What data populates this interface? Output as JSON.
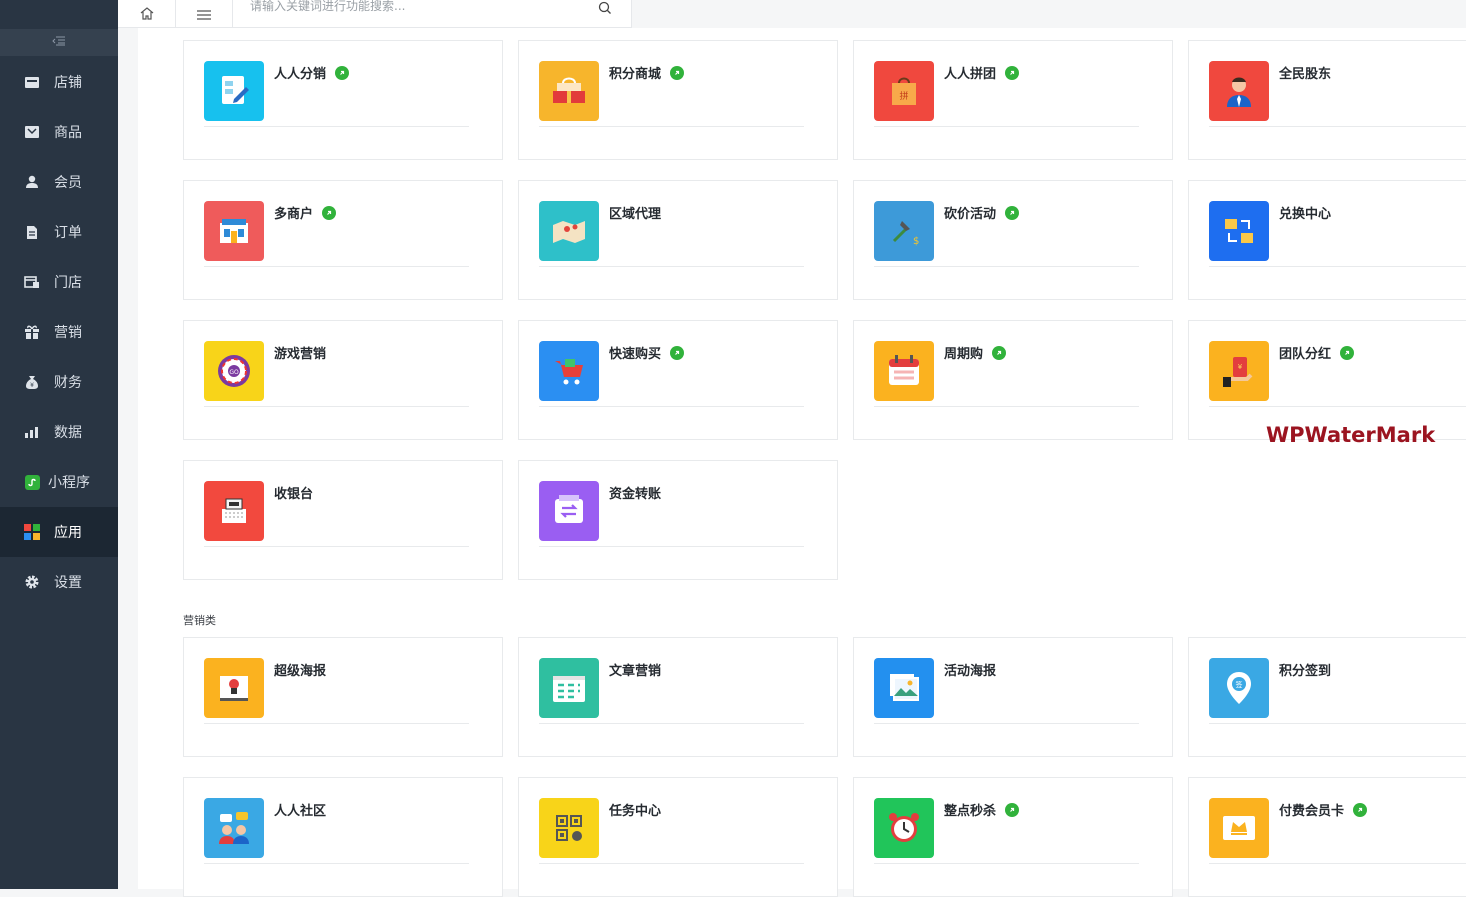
{
  "topbar": {
    "search_placeholder": "请输入关键词进行功能搜索..."
  },
  "sidebar": {
    "collapse_icon": "indent-icon",
    "items": [
      {
        "label": "店铺",
        "icon": "shop-icon"
      },
      {
        "label": "商品",
        "icon": "goods-icon"
      },
      {
        "label": "会员",
        "icon": "user-icon"
      },
      {
        "label": "订单",
        "icon": "order-icon"
      },
      {
        "label": "门店",
        "icon": "store-icon"
      },
      {
        "label": "营销",
        "icon": "gift-icon"
      },
      {
        "label": "财务",
        "icon": "money-bag-icon"
      },
      {
        "label": "数据",
        "icon": "chart-icon"
      },
      {
        "label": "小程序",
        "icon": "miniprogram-icon"
      },
      {
        "label": "应用",
        "icon": "apps-icon",
        "active": true
      },
      {
        "label": "设置",
        "icon": "gear-icon"
      }
    ]
  },
  "apps": [
    {
      "name": "人人分销",
      "badge": true,
      "color": "#17c1ee",
      "icon": "distribution-icon"
    },
    {
      "name": "积分商城",
      "badge": true,
      "color": "#f7b52c",
      "icon": "points-mall-icon"
    },
    {
      "name": "人人拼团",
      "badge": true,
      "color": "#f0483e",
      "icon": "group-buy-icon"
    },
    {
      "name": "全民股东",
      "badge": false,
      "color": "#f0483e",
      "icon": "shareholder-icon"
    },
    {
      "name": "多商户",
      "badge": true,
      "color": "#ef5b5b",
      "icon": "multi-merchant-icon"
    },
    {
      "name": "区域代理",
      "badge": false,
      "color": "#2ec0c9",
      "icon": "region-map-icon"
    },
    {
      "name": "砍价活动",
      "badge": true,
      "color": "#3d9ad9",
      "icon": "bargain-icon"
    },
    {
      "name": "兑换中心",
      "badge": false,
      "color": "#1e6ef0",
      "icon": "exchange-icon"
    },
    {
      "name": "游戏营销",
      "badge": false,
      "color": "#f8d419",
      "icon": "wheel-icon"
    },
    {
      "name": "快速购买",
      "badge": true,
      "color": "#2b8ff2",
      "icon": "cart-icon"
    },
    {
      "name": "周期购",
      "badge": true,
      "color": "#fbb21f",
      "icon": "calendar-icon"
    },
    {
      "name": "团队分红",
      "badge": true,
      "color": "#fbb21f",
      "icon": "red-packet-icon"
    },
    {
      "name": "收银台",
      "badge": false,
      "color": "#f2493e",
      "icon": "cashier-icon"
    },
    {
      "name": "资金转账",
      "badge": false,
      "color": "#9a5ef2",
      "icon": "transfer-icon"
    }
  ],
  "section2": {
    "label": "营销类",
    "apps": [
      {
        "name": "超级海报",
        "badge": false,
        "color": "#fbb21f",
        "icon": "poster-icon"
      },
      {
        "name": "文章营销",
        "badge": false,
        "color": "#2fbfa0",
        "icon": "article-icon"
      },
      {
        "name": "活动海报",
        "badge": false,
        "color": "#2390ef",
        "icon": "photo-icon"
      },
      {
        "name": "积分签到",
        "badge": false,
        "color": "#3aa8e4",
        "icon": "sign-in-icon"
      },
      {
        "name": "人人社区",
        "badge": false,
        "color": "#3aa8e4",
        "icon": "community-icon"
      },
      {
        "name": "任务中心",
        "badge": false,
        "color": "#f8d419",
        "icon": "qr-task-icon"
      },
      {
        "name": "整点秒杀",
        "badge": true,
        "color": "#21c55a",
        "icon": "alarm-clock-icon"
      },
      {
        "name": "付费会员卡",
        "badge": true,
        "color": "#fbb21f",
        "icon": "vip-card-icon"
      }
    ]
  },
  "watermark": "WPWaterMark"
}
